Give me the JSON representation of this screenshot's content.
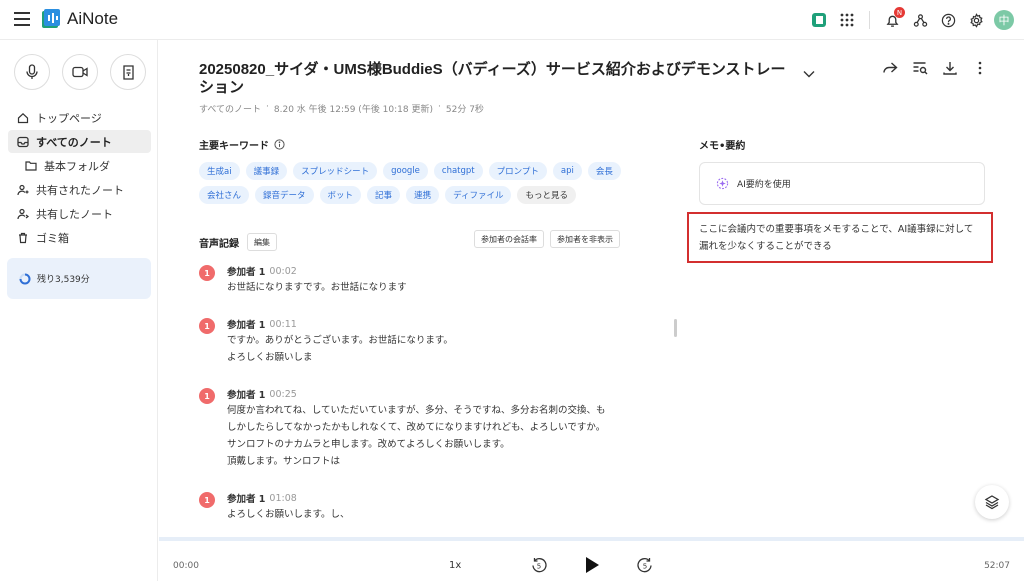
{
  "app": {
    "name": "AiNote"
  },
  "topbar": {
    "notification_badge": "N",
    "avatar_initial": "中"
  },
  "sidebar": {
    "nav": [
      {
        "label": "トップページ"
      },
      {
        "label": "すべてのノート"
      },
      {
        "label": "基本フォルダ"
      },
      {
        "label": "共有されたノート"
      },
      {
        "label": "共有したノート"
      },
      {
        "label": "ゴミ箱"
      }
    ],
    "remaining_label": "残り3,539分"
  },
  "note": {
    "title": "20250820_サイダ・UMS様BuddieS（バディーズ）サービス紹介およびデモンストレーション",
    "breadcrumb": "すべてのノート",
    "date": "8.20 水 午後 12:59 (午後 10:18 更新)",
    "duration": "52分 7秒"
  },
  "keywords": {
    "title": "主要キーワード",
    "items": [
      "生成ai",
      "議事録",
      "スプレッドシート",
      "google",
      "chatgpt",
      "プロンプト",
      "api",
      "会長",
      "会社さん",
      "録音データ",
      "ボット",
      "記事",
      "連携",
      "ディファイル"
    ],
    "more": "もっと見る"
  },
  "recording": {
    "title": "音声記録",
    "edit": "編集",
    "speaker_rate": "参加者の会話率",
    "hide_speakers": "参加者を非表示",
    "entries": [
      {
        "badge": "1",
        "speaker": "参加者 1",
        "time": "00:02",
        "text": "お世話になりますです。お世話になります"
      },
      {
        "badge": "1",
        "speaker": "参加者 1",
        "time": "00:11",
        "text": "ですか。ありがとうございます。お世話になります。\nよろしくお願いしま"
      },
      {
        "badge": "1",
        "speaker": "参加者 1",
        "time": "00:25",
        "text": "何度か言われてね、していただいていますが、多分、そうですね、多分お名刺の交換、も\nしかしたらしてなかったかもしれなくて、改めてになりますけれども、よろしいですか。\nサンロフトのナカムラと申します。改めてよろしくお願いします。\n頂戴します。サンロフトは"
      },
      {
        "badge": "1",
        "speaker": "参加者 1",
        "time": "01:08",
        "text": "よろしくお願いします。し、"
      }
    ]
  },
  "memo": {
    "title": "メモ•要約",
    "ai_button": "AI要約を使用",
    "note_text": "ここに会議内での重要事項をメモすることで、AI議事録に対して漏れを少なくすることができる"
  },
  "player": {
    "current": "00:00",
    "total": "52:07",
    "speed": "1x",
    "skip_back": "5",
    "skip_fwd": "5"
  },
  "colors": {
    "accent": "#2f6fd6",
    "chip_bg": "#e9f2fd",
    "speaker_badge": "#f06b6b",
    "highlight_border": "#d32f2f"
  }
}
